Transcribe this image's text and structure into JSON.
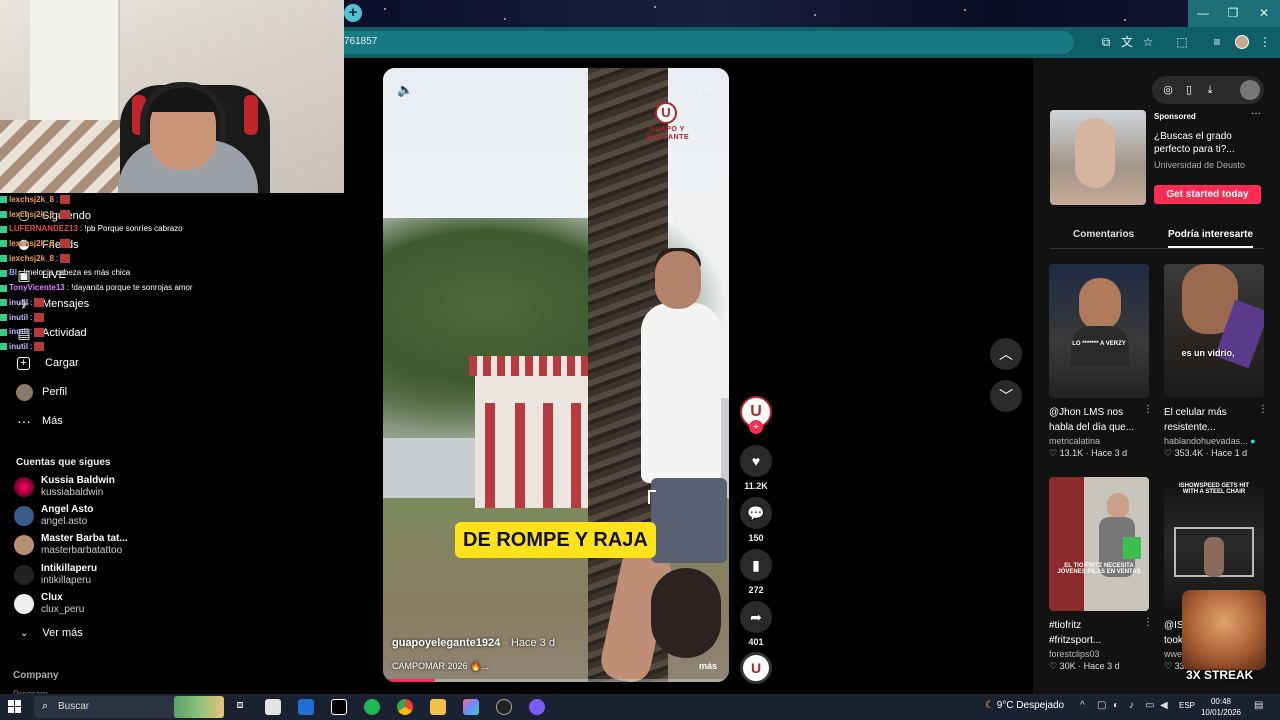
{
  "browser": {
    "url_fragment": "761857"
  },
  "chat": [
    {
      "user": "lexchsj2k_8",
      "user_color": "#f0a040",
      "msg": ":"
    },
    {
      "user": "lexchsj2k_8",
      "user_color": "#f0a040",
      "msg": ":"
    },
    {
      "user": "LUFERNANDEZ13",
      "user_color": "#e04b4b",
      "msg": ": !pb Porque sonríes cabrazo"
    },
    {
      "user": "lexchsj2k_8",
      "user_color": "#f0a040",
      "msg": ":"
    },
    {
      "user": "lexchsj2k_8",
      "user_color": "#f0a040",
      "msg": ":"
    },
    {
      "user": "Bl",
      "user_color": "#7fb3ff",
      "msg": ": !melocja cabeza es más chica"
    },
    {
      "user": "TonyVicente13",
      "user_color": "#e07cff",
      "msg": ": !dayanita porque te sonrojas amor"
    },
    {
      "user": "inutil",
      "user_color": "#b8b8ff",
      "msg": ":"
    },
    {
      "user": "inutil",
      "user_color": "#b8b8ff",
      "msg": ":"
    },
    {
      "user": "inutil",
      "user_color": "#b8b8ff",
      "msg": ":"
    },
    {
      "user": "inutil",
      "user_color": "#b8b8ff",
      "msg": ":"
    }
  ],
  "nav": {
    "items": [
      {
        "label": "Siguiendo",
        "icon": "following-icon"
      },
      {
        "label": "Friends",
        "icon": "friends-icon"
      },
      {
        "label": "LIVE",
        "icon": "live-icon"
      },
      {
        "label": "Mensajes",
        "icon": "messages-icon"
      },
      {
        "label": "Actividad",
        "icon": "activity-icon"
      },
      {
        "label": "Cargar",
        "icon": "upload-icon"
      },
      {
        "label": "Perfil",
        "icon": "profile-icon"
      },
      {
        "label": "Más",
        "icon": "more-icon"
      }
    ],
    "following_header": "Cuentas que sigues",
    "following": [
      {
        "name": "Kussia Baldwin",
        "handle": "kussiabaldwin"
      },
      {
        "name": "Angel Asto",
        "handle": "angel.asto"
      },
      {
        "name": "Master Barba tat...",
        "handle": "masterbarbatattoo"
      },
      {
        "name": "Intikillaperu",
        "handle": "intikillaperu"
      },
      {
        "name": "Clux",
        "handle": "clux_peru"
      }
    ],
    "ver_mas": "Ver más",
    "company": "Company",
    "program": "Program"
  },
  "video": {
    "logo_letter": "U",
    "logo_text": "GUAPO Y ELEGANTE",
    "caption": "DE ROMPE Y RAJA",
    "username": "guapoyelegante1924",
    "ago": "· Hace 3 d",
    "description": "CAMPOMAR 2026 🔥...",
    "more": "más",
    "progress": 0.15
  },
  "actions": {
    "likes": "11.2K",
    "comments": "150",
    "saves": "272",
    "shares": "401"
  },
  "ad": {
    "sponsored": "Sponsored",
    "title": "¿Buscas el grado perfecto para ti?...",
    "advertiser": "Universidad de Deusto",
    "cta": "Get started today"
  },
  "tabs": {
    "comments": "Comentarios",
    "recommended": "Podría interesarte"
  },
  "cards": [
    {
      "title_l1": "@Jhon LMS nos",
      "title_l2": "habla del día que...",
      "author": "metricalatina",
      "likes": "13.1K",
      "ago": "Hace 3 d",
      "overlay": "LO ******* A VERZY"
    },
    {
      "title_l1": "El celular más",
      "title_l2": "resistente...",
      "author": "hablandohuevadas...",
      "likes": "353.4K",
      "ago": "Hace 1 d",
      "overlay": "es un vidrio,"
    },
    {
      "title_l1": "#tiofritz",
      "title_l2": "#fritzsport...",
      "author": "forestclips03",
      "likes": "30K",
      "ago": "Hace 3 d",
      "overlay": "EL TIO FRITZ NECESITA JÓVENES PILAS EN VENTAS"
    },
    {
      "title_l1": "@ISI",
      "title_l2": "took",
      "author": "wwe",
      "likes": "332.1K",
      "ago": "2025-12-3",
      "overlay": "ISHOWSPEED GETS HIT WITH A STEEL CHAIR"
    }
  ],
  "streak": "3X STREAK",
  "taskbar": {
    "search": "Buscar",
    "weather": "9°C  Despejado",
    "lang": "ESP",
    "time": "00:48",
    "date": "10/01/2026"
  }
}
